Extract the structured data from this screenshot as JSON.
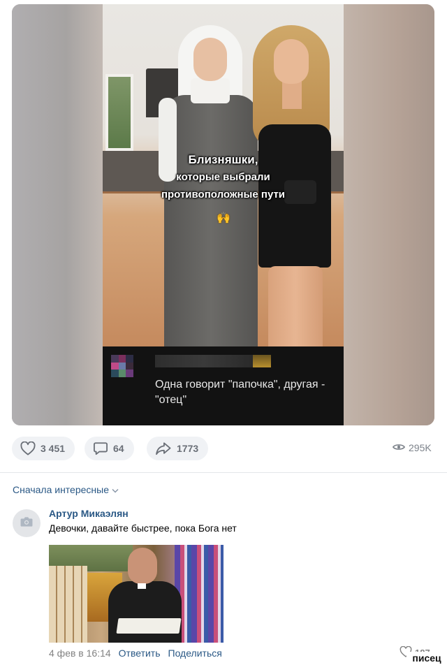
{
  "post": {
    "video_caption": {
      "line1": "Близняшки,",
      "line2": "которые выбрали",
      "line3": "противоположные пути",
      "emoji": "🙌"
    },
    "embedded_comment": {
      "text": "Одна говорит \"папочка\", другая - \"отец\""
    }
  },
  "actions": {
    "likes": "3 451",
    "comments": "64",
    "shares": "1773",
    "views": "295K"
  },
  "comments_section": {
    "sort_label": "Сначала интересные",
    "comment": {
      "author": "Артур Микаэлян",
      "text": "Девочки, давайте быстрее, пока Бога нет",
      "date": "4 фев в 16:14",
      "reply_label": "Ответить",
      "share_label": "Поделиться",
      "likes": "187"
    }
  },
  "watermark": "писец",
  "colors": {
    "link": "#2a5885",
    "action_bg": "#f0f2f5",
    "muted": "#828282"
  }
}
